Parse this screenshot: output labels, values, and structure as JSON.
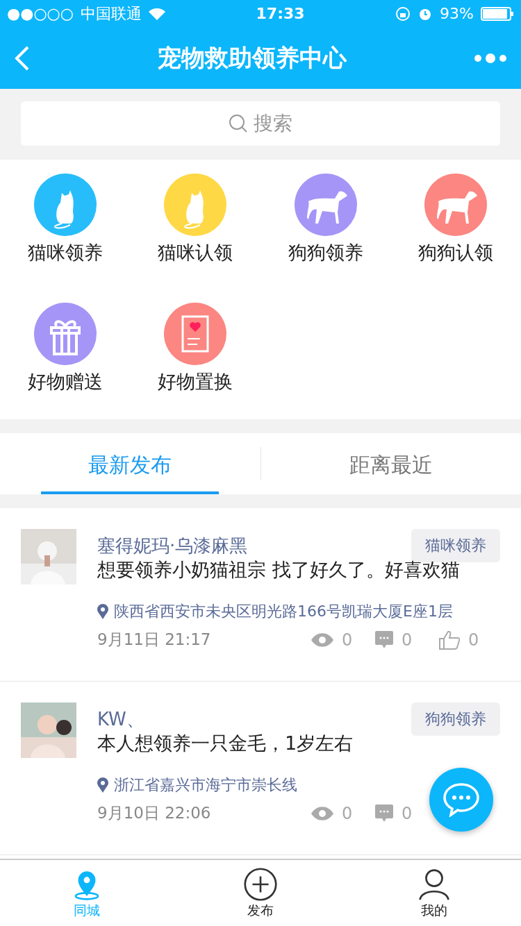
{
  "status_bar": {
    "signal": "●●○○○",
    "carrier": "中国联通",
    "time": "17:33",
    "battery": "93%"
  },
  "nav": {
    "title": "宠物救助领养中心"
  },
  "search": {
    "placeholder": "搜索"
  },
  "categories": [
    {
      "label": "猫咪领养",
      "kind": "cat",
      "color": "#27bdfb"
    },
    {
      "label": "猫咪认领",
      "kind": "cat",
      "color": "#ffd845"
    },
    {
      "label": "狗狗领养",
      "kind": "dog",
      "color": "#a595f7"
    },
    {
      "label": "狗狗认领",
      "kind": "dog",
      "color": "#fb8682"
    },
    {
      "label": "好物赠送",
      "kind": "gift",
      "color": "#a595f7"
    },
    {
      "label": "好物置换",
      "kind": "card",
      "color": "#fb8682"
    }
  ],
  "tabs": [
    {
      "label": "最新发布",
      "selected": true
    },
    {
      "label": "距离最近",
      "selected": false
    }
  ],
  "posts": [
    {
      "author": "塞得妮玛·乌漆麻黑",
      "tag": "猫咪领养",
      "text": "想要领养小奶猫祖宗 找了好久了。好喜欢猫",
      "location": "陕西省西安市未央区明光路166号凯瑞大厦E座1层",
      "date": "9月11日 21:17",
      "views": "0",
      "comments": "0",
      "likes": "0"
    },
    {
      "author": "KW、",
      "tag": "狗狗领养",
      "text": "本人想领养一只金毛，1岁左右",
      "location": "浙江省嘉兴市海宁市崇长线",
      "date": "9月10日 22:06",
      "views": "0",
      "comments": "0"
    }
  ],
  "bottom_nav": [
    {
      "label": "同城",
      "kind": "pin",
      "selected": true
    },
    {
      "label": "发布",
      "kind": "plus",
      "selected": false
    },
    {
      "label": "我的",
      "kind": "person",
      "selected": false
    }
  ]
}
